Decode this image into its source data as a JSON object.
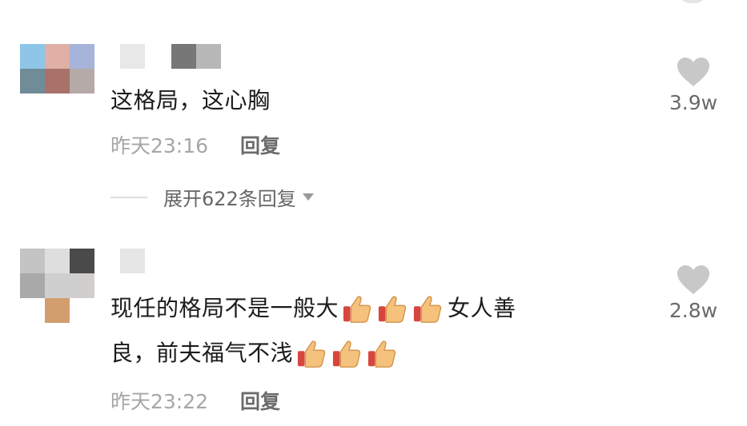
{
  "comments": [
    {
      "text": "这格局，这心胸",
      "time": "昨天23:16",
      "reply_label": "回复",
      "like_count": "3.9w",
      "expand_label": "展开622条回复",
      "avatar_colors": [
        "#8fc6e8",
        "#e0b0a6",
        "#a7b3d8",
        "#6f8c97",
        "#a8726b",
        "#b5aaa8"
      ],
      "name_colors": [
        "#e8e8e8",
        "#ffffff",
        "#777777",
        "#b7b7b7"
      ]
    },
    {
      "text_line1": "现任的格局不是一般大",
      "text_line1_tail": "女人善",
      "text_line2": "良，前夫福气不浅",
      "time": "昨天23:22",
      "reply_label": "回复",
      "like_count": "2.8w",
      "avatar_colors": [
        "#c4c4c4",
        "#dedede",
        "#4a4a4a",
        "#a9a9a9",
        "#cfcfcf",
        "#d0cfcd",
        "#ffffff",
        "#d39e6e",
        "#ffffff"
      ],
      "name_colors": [
        "#e6e6e6"
      ]
    }
  ],
  "icons": {
    "like": "heart-icon",
    "thumbs": "thumbs-up-emoji",
    "expand": "caret-down-icon"
  },
  "colors": {
    "heart": "#c8c8c8",
    "time": "#a6a6a6",
    "reply": "#6b6b6b"
  }
}
